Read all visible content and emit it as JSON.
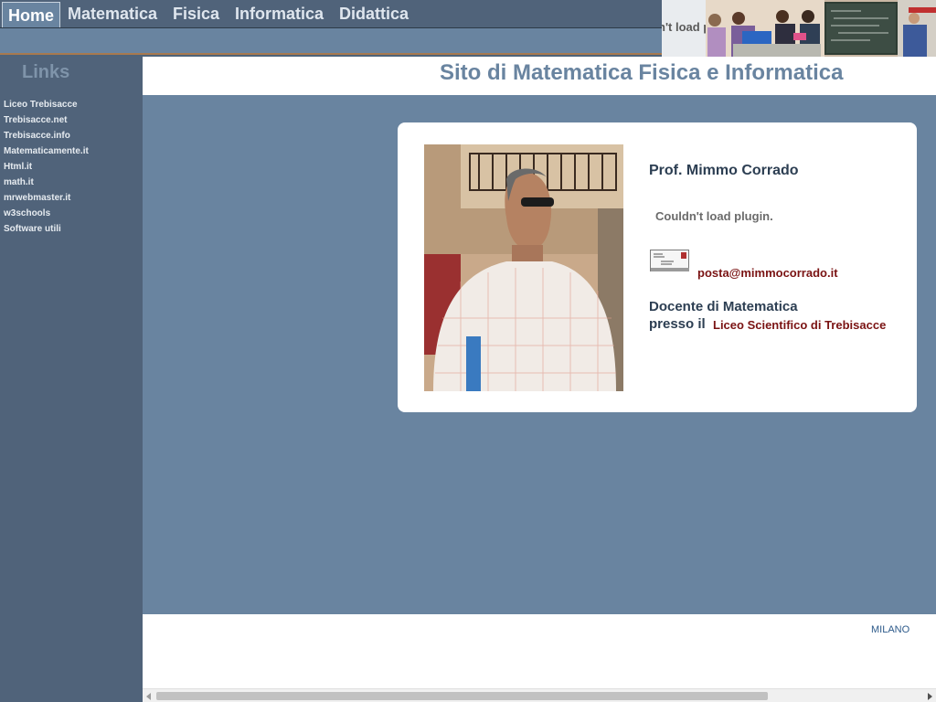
{
  "nav": {
    "items": [
      {
        "label": "Home",
        "active": true
      },
      {
        "label": "Matematica"
      },
      {
        "label": "Fisica"
      },
      {
        "label": "Informatica"
      },
      {
        "label": "Didattica"
      }
    ]
  },
  "banner": {
    "plugin_text": "n't load p"
  },
  "sidebar": {
    "title": "Links",
    "links": [
      {
        "label": "Liceo Trebisacce"
      },
      {
        "label": "Trebisacce.net"
      },
      {
        "label": "Trebisacce.info"
      },
      {
        "label": "Matematicamente.it"
      },
      {
        "label": "Html.it"
      },
      {
        "label": "math.it"
      },
      {
        "label": "mrwebmaster.it"
      },
      {
        "label": "w3schools"
      },
      {
        "label": "Software utili"
      }
    ]
  },
  "header": {
    "site_title": "Sito di Matematica Fisica e Informatica"
  },
  "card": {
    "name": "Prof. Mimmo Corrado",
    "plugin_message": "Couldn't load plugin.",
    "email": "posta@mimmocorrado.it",
    "teacher_line1": "Docente di Matematica",
    "teacher_line2": "presso il",
    "school_link": "Liceo Scientifico di Trebisacce"
  },
  "footer": {
    "city": "MILANO"
  },
  "colors": {
    "nav_bg": "#50637a",
    "accent_blue": "#6984a0",
    "link_red": "#7a1313"
  },
  "icons": {
    "email": "envelope-icon",
    "scroll_left": "triangle-left-icon",
    "scroll_right": "triangle-right-icon"
  }
}
